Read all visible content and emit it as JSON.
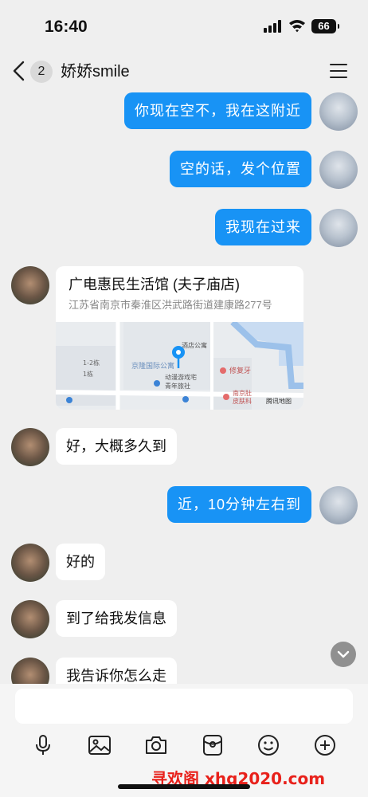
{
  "status_bar": {
    "time": "16:40",
    "battery": "66"
  },
  "nav": {
    "unread_count": "2",
    "title": "娇娇smile"
  },
  "messages": [
    {
      "from": "me",
      "text": "你现在空不，我在这附近"
    },
    {
      "from": "me",
      "text": "空的话，发个位置"
    },
    {
      "from": "me",
      "text": "我现在过来"
    },
    {
      "from": "other",
      "type": "location",
      "name": "广电惠民生活馆 (夫子庙店)",
      "address": "江苏省南京市秦淮区洪武路街道建康路277号",
      "map_labels": [
        "1-2栋",
        "1栋",
        "京隆国际公寓",
        "酒店公寓",
        "动漫游戏宅",
        "青年旅社",
        "修复牙",
        "南京肚",
        "皮肤科",
        "腾讯地图"
      ]
    },
    {
      "from": "other",
      "text": "好，大概多久到"
    },
    {
      "from": "me",
      "text": "近，10分钟左右到"
    },
    {
      "from": "other",
      "text": "好的"
    },
    {
      "from": "other",
      "text": "到了给我发信息"
    },
    {
      "from": "other",
      "text": "我告诉你怎么走"
    }
  ],
  "input": {
    "placeholder": ""
  },
  "toolbar": [
    "microphone-icon",
    "image-icon",
    "camera-icon",
    "red-packet-icon",
    "emoji-icon",
    "plus-icon"
  ],
  "watermark": "寻欢阁 xhg2020.com",
  "colors": {
    "accent": "#1893f5",
    "background": "#efefef",
    "watermark": "#e8211b"
  }
}
